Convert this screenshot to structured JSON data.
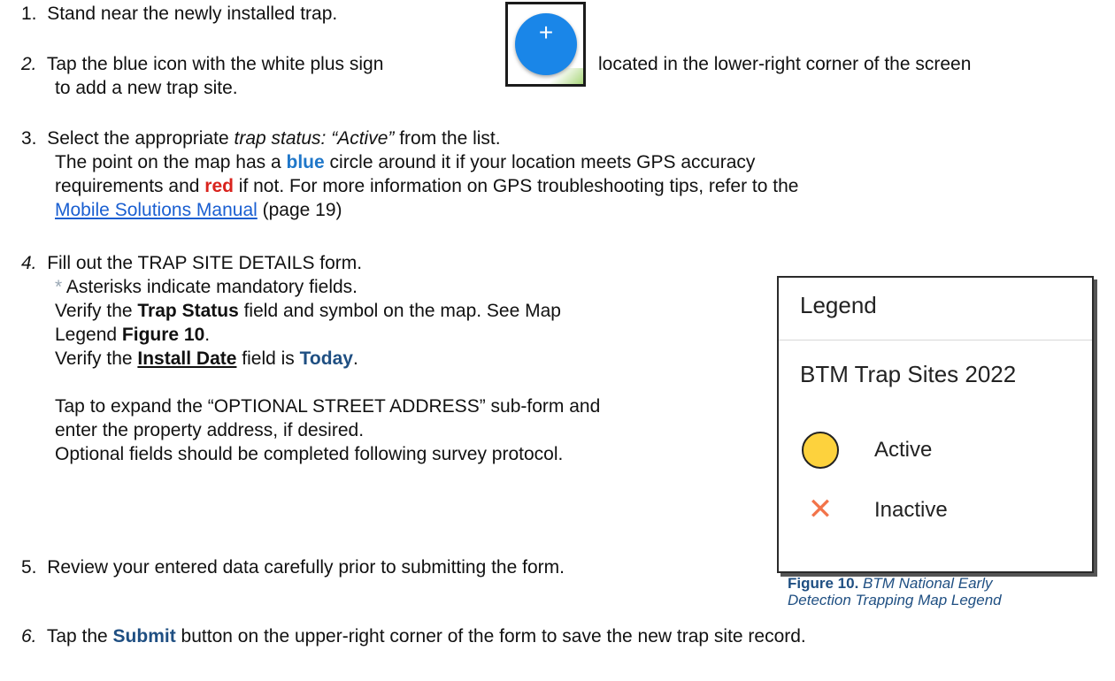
{
  "steps": {
    "s1": {
      "num": "1.",
      "text": "Stand near the newly installed trap."
    },
    "s2": {
      "num": "2.",
      "before_icon": "Tap the blue icon with the white plus sign",
      "after_icon": "located in the lower-right corner of the screen",
      "line2": "to add a new trap site."
    },
    "s3": {
      "num": "3.",
      "l1_pre": "Select the appropriate ",
      "l1_em": "trap status: “Active”",
      "l1_post": " from the list.",
      "l2_pre": "The point on the map has a ",
      "l2_blue": "blue",
      "l2_post": " circle around it if your location meets GPS accuracy",
      "l3_pre": "requirements and ",
      "l3_red": "red",
      "l3_post": " if not. For more information on GPS troubleshooting tips, refer to the",
      "l4_link": "Mobile Solutions Manual",
      "l4_post": " (page 19)"
    },
    "s4": {
      "num": "4.",
      "l1": "Fill out the TRAP SITE DETAILS form.",
      "l2_star": "*",
      "l2_post": " Asterisks indicate mandatory fields.",
      "l3_pre": "Verify the ",
      "l3_bold": "Trap Status",
      "l3_post": " field and symbol on the map.  See Map",
      "l4_pre": "Legend ",
      "l4_bold": "Figure 10",
      "l4_post": ".",
      "l5_pre": "Verify the ",
      "l5_bold": "Install Date",
      "l5_mid": " field is ",
      "l5_today": "Today",
      "l5_post": ".",
      "l6": "Tap to expand the “OPTIONAL STREET ADDRESS” sub-form and",
      "l7": "enter the property address, if desired.",
      "l8": "Optional fields should be completed following survey protocol."
    },
    "s5": {
      "num": "5.",
      "text": "Review your entered data carefully prior to submitting the form."
    },
    "s6": {
      "num": "6.",
      "pre": "Tap the ",
      "bold": "Submit",
      "post": " button on the upper-right corner of the form to save the new trap site record."
    }
  },
  "plus_icon": {
    "glyph": "+",
    "color": "#1a86e8"
  },
  "legend": {
    "title": "Legend",
    "layer": "BTM Trap Sites 2022",
    "items": [
      {
        "label": "Active",
        "icon": "yellow-circle-icon",
        "color": "#fdd23d"
      },
      {
        "label": "Inactive",
        "icon": "x-mark-icon",
        "glyph": "✕",
        "color": "#f2744a"
      }
    ]
  },
  "caption": {
    "fig": "Figure 10.",
    "l1": " BTM National Early",
    "l2": "Detection Trapping Map Legend"
  }
}
